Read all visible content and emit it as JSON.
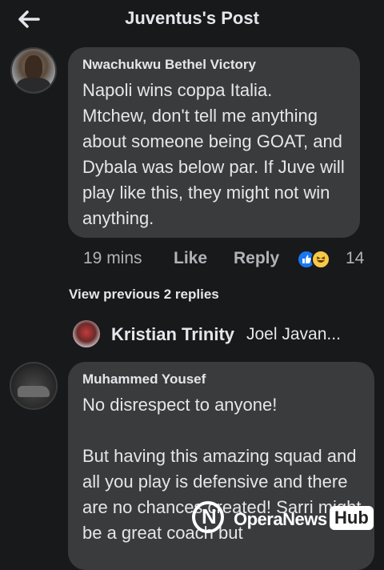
{
  "header": {
    "title": "Juventus's Post",
    "back_icon": "arrow-left-icon"
  },
  "comments": [
    {
      "author": "Nwachukwu Bethel Victory",
      "text": "Napoli wins coppa Italia.\nMtchew, don't tell me anything about someone being GOAT, and Dybala was below par. If Juve will play like this, they might not win anything.",
      "time": "19 mins",
      "like_label": "Like",
      "reply_label": "Reply",
      "reaction_count": "14",
      "reactions": [
        "like-reaction-icon",
        "haha-reaction-icon"
      ]
    },
    {
      "author": "Muhammed Yousef",
      "text": "No disrespect to anyone!\n\nBut having this amazing squad and all you play is defensive and there are no chances created! Sarri might be a great coach but"
    }
  ],
  "replies": {
    "view_previous": "View previous 2 replies",
    "latest_author": "Kristian Trinity",
    "latest_preview": "Joel Javan..."
  },
  "watermark": {
    "text": "OperaNews",
    "hub": "Hub"
  },
  "colors": {
    "background": "#18191a",
    "bubble": "#3a3b3c",
    "primary_text": "#e4e6eb",
    "secondary_text": "#b0b3b8",
    "like_blue": "#1877f2"
  }
}
